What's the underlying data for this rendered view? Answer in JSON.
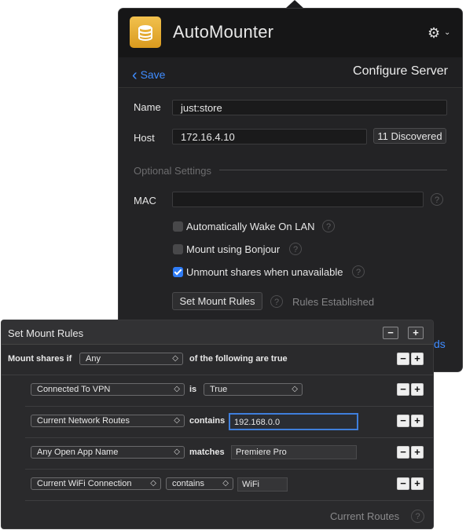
{
  "app": {
    "title": "AutoMounter"
  },
  "nav": {
    "back_label": "Save",
    "title": "Configure Server"
  },
  "form": {
    "name_label": "Name",
    "name_value": "just:store",
    "host_label": "Host",
    "host_value": "172.16.4.10",
    "discovered_label": "11 Discovered",
    "optional_heading": "Optional Settings",
    "mac_label": "MAC",
    "mac_value": "",
    "options": [
      {
        "label": "Automatically Wake On LAN",
        "checked": false
      },
      {
        "label": "Mount using Bonjour",
        "checked": false
      },
      {
        "label": "Unmount shares when unavailable",
        "checked": true
      }
    ],
    "set_rules_label": "Set Mount Rules",
    "rules_status": "Rules Established",
    "partial_text": "ds"
  },
  "rules": {
    "title": "Set Mount Rules",
    "condition_prefix": "Mount shares if",
    "condition_select": "Any",
    "condition_suffix": "of the following are true",
    "rows": [
      {
        "field": "Connected To VPN",
        "operator": "is",
        "value": "True"
      },
      {
        "field": "Current Network Routes",
        "operator": "contains",
        "value": "192.168.0.0"
      },
      {
        "field": "Any Open App Name",
        "operator": "matches",
        "value": "Premiere Pro"
      },
      {
        "field": "Current WiFi Connection",
        "operator": "contains",
        "value": "WiFi"
      }
    ],
    "footer_label": "Current Routes"
  },
  "icons": {
    "help": "?",
    "minus": "−",
    "plus": "+",
    "chevron_updown": "⌃⌄",
    "gear": "⚙",
    "chevron_down": "⌄",
    "back": "‹"
  },
  "colors": {
    "accent": "#3f8cff",
    "app_icon": "#e8ac2c"
  }
}
